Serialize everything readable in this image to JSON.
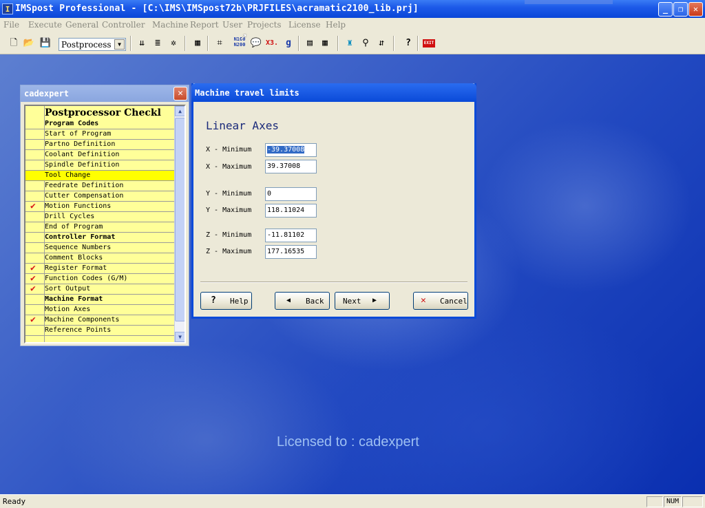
{
  "window": {
    "title": "IMSpost Professional - [C:\\IMS\\IMSpost72b\\PRJFILES\\acramatic2100_lib.prj]",
    "controls": {
      "minimize": "_",
      "maximize": "❐",
      "close": "✕"
    }
  },
  "menu": [
    "File",
    "Execute",
    "General",
    "Controller",
    "Machine",
    "Report",
    "User",
    "Projects",
    "License",
    "Help"
  ],
  "toolbar": {
    "mode_select": "Postprocess",
    "labels": {
      "n100": "N100\nN200",
      "x3": "X3.",
      "exit": "EXIT"
    }
  },
  "panel": {
    "title": "cadexpert",
    "header": "Postprocessor Checkl",
    "items": [
      {
        "label": "Program Codes",
        "section": true,
        "checked": false
      },
      {
        "label": "Start of Program",
        "section": false,
        "checked": false
      },
      {
        "label": "Partno Definition",
        "section": false,
        "checked": false
      },
      {
        "label": "Coolant Definition",
        "section": false,
        "checked": false
      },
      {
        "label": "Spindle Definition",
        "section": false,
        "checked": false
      },
      {
        "label": "Tool Change",
        "section": false,
        "checked": false,
        "selected": true
      },
      {
        "label": "Feedrate Definition",
        "section": false,
        "checked": false
      },
      {
        "label": "Cutter Compensation",
        "section": false,
        "checked": false
      },
      {
        "label": "Motion Functions",
        "section": false,
        "checked": true
      },
      {
        "label": "Drill Cycles",
        "section": false,
        "checked": false
      },
      {
        "label": "End of Program",
        "section": false,
        "checked": false
      },
      {
        "label": "Controller Format",
        "section": true,
        "checked": false
      },
      {
        "label": "Sequence Numbers",
        "section": false,
        "checked": false
      },
      {
        "label": "Comment Blocks",
        "section": false,
        "checked": false
      },
      {
        "label": "Register Format",
        "section": false,
        "checked": true
      },
      {
        "label": "Function Codes (G/M)",
        "section": false,
        "checked": true
      },
      {
        "label": "Sort Output",
        "section": false,
        "checked": true
      },
      {
        "label": "Machine Format",
        "section": true,
        "checked": false
      },
      {
        "label": "Motion Axes",
        "section": false,
        "checked": false
      },
      {
        "label": "Machine Components",
        "section": false,
        "checked": true
      },
      {
        "label": "Reference Points",
        "section": false,
        "checked": false
      }
    ]
  },
  "dialog": {
    "title": "Machine travel limits",
    "heading": "Linear Axes",
    "fields": [
      {
        "label": "X - Minimum",
        "value": "-39.37008"
      },
      {
        "label": "X - Maximum",
        "value": "39.37008"
      },
      {
        "label": "Y - Minimum",
        "value": "0"
      },
      {
        "label": "Y - Maximum",
        "value": "118.11024"
      },
      {
        "label": "Z - Minimum",
        "value": "-11.81102"
      },
      {
        "label": "Z - Maximum",
        "value": "177.16535"
      }
    ],
    "buttons": {
      "help": "Help",
      "back": "Back",
      "next": "Next",
      "cancel": "Cancel"
    }
  },
  "desktop": {
    "licensed_text": "Licensed to : cadexpert"
  },
  "status": {
    "text": "Ready",
    "num": "NUM"
  }
}
